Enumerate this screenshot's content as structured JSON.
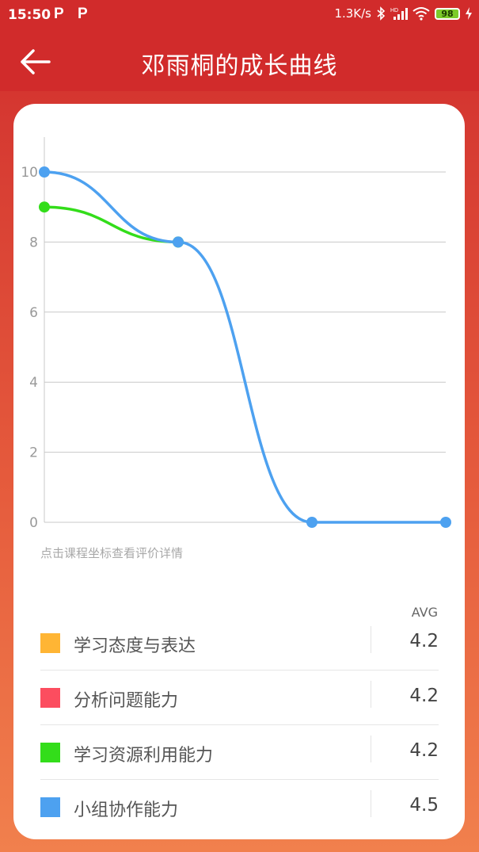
{
  "status_bar": {
    "time": "15:50",
    "notif_icons": [
      "P",
      "P"
    ],
    "net_speed": "1.3K/s",
    "battery": "98"
  },
  "header": {
    "title": "邓雨桐的成长曲线"
  },
  "chart_data": {
    "type": "line",
    "x": [
      0,
      1,
      2,
      3
    ],
    "ylim": [
      0,
      10
    ],
    "yticks": [
      "0",
      "2",
      "4",
      "6",
      "8",
      "10"
    ],
    "grid": true,
    "series": [
      {
        "name": "学习资源利用能力",
        "color": "#33dd1a",
        "values": [
          9,
          8
        ]
      },
      {
        "name": "小组协作能力",
        "color": "#4da1f0",
        "values": [
          10,
          8,
          0,
          0
        ]
      }
    ]
  },
  "hint": "点击课程坐标查看评价详情",
  "legend": {
    "avg_header": "AVG",
    "items": [
      {
        "label": "学习态度与表达",
        "avg": "4.2",
        "color": "#ffb534"
      },
      {
        "label": "分析问题能力",
        "avg": "4.2",
        "color": "#fc4d5f"
      },
      {
        "label": "学习资源利用能力",
        "avg": "4.2",
        "color": "#33dd1a"
      },
      {
        "label": "小组协作能力",
        "avg": "4.5",
        "color": "#4da1f0"
      }
    ]
  }
}
